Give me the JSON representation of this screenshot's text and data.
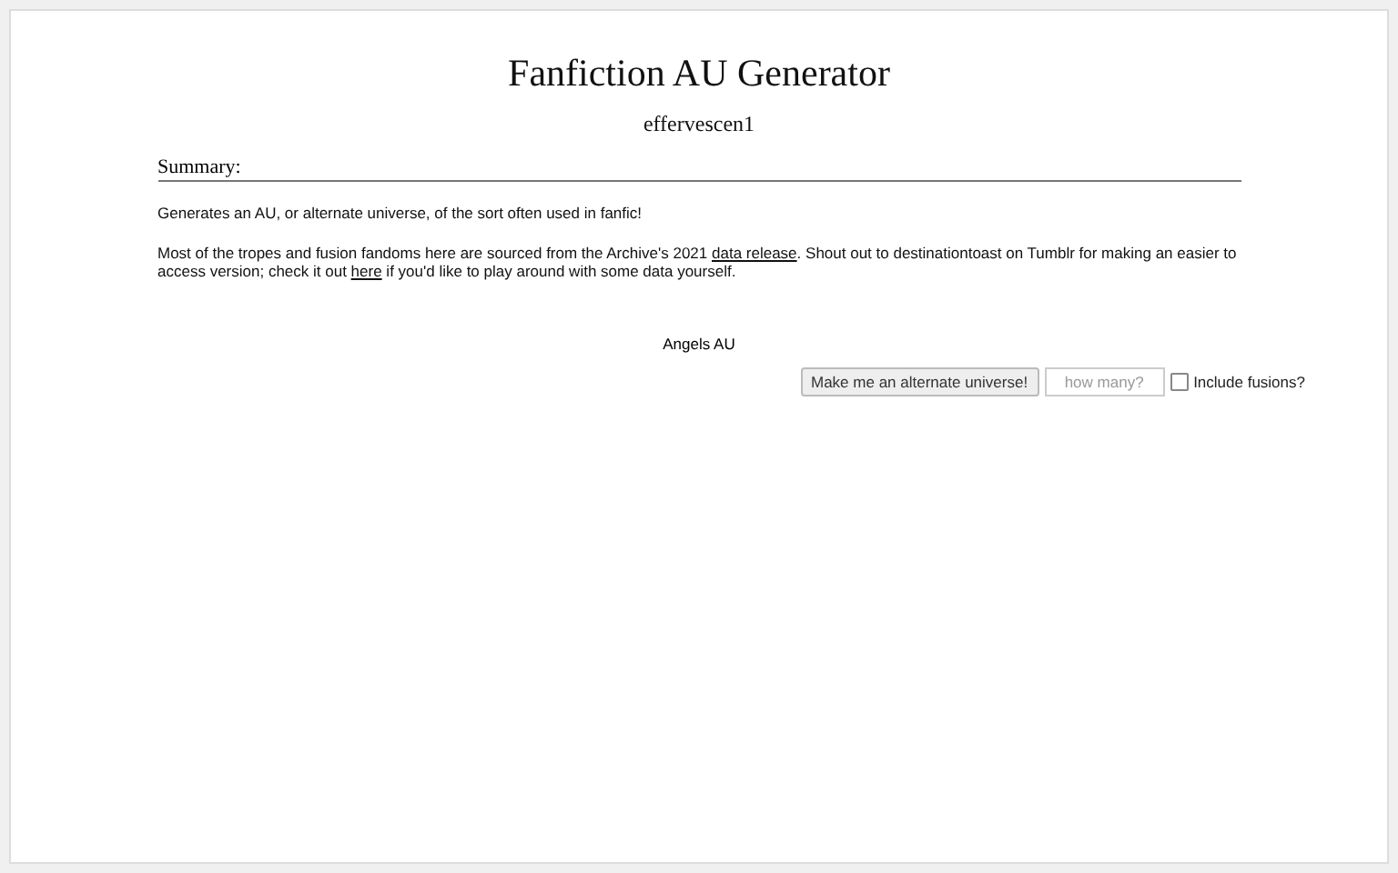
{
  "title": "Fanfiction AU Generator",
  "author": "effervescen1",
  "summary_heading": "Summary:",
  "paragraphs": [
    [
      {
        "kind": "text",
        "text": "Generates an AU, or alternate universe, of the sort often used in fanfic!"
      }
    ],
    [
      {
        "kind": "text",
        "text": "Most of the tropes and fusion fandoms here are sourced from the Archive's 2021 "
      },
      {
        "kind": "link",
        "text": "data release"
      },
      {
        "kind": "text",
        "text": ". Shout out to destinationtoast on Tumblr for making an easier to access version; check it out "
      },
      {
        "kind": "link",
        "text": "here"
      },
      {
        "kind": "text",
        "text": " if you'd like to play around with some data yourself."
      }
    ]
  ],
  "result": "Angels AU",
  "controls": {
    "button": "Make me an alternate universe!",
    "count_placeholder": "how many?",
    "fusions": {
      "label": "Include fusions?",
      "checked": false
    }
  }
}
